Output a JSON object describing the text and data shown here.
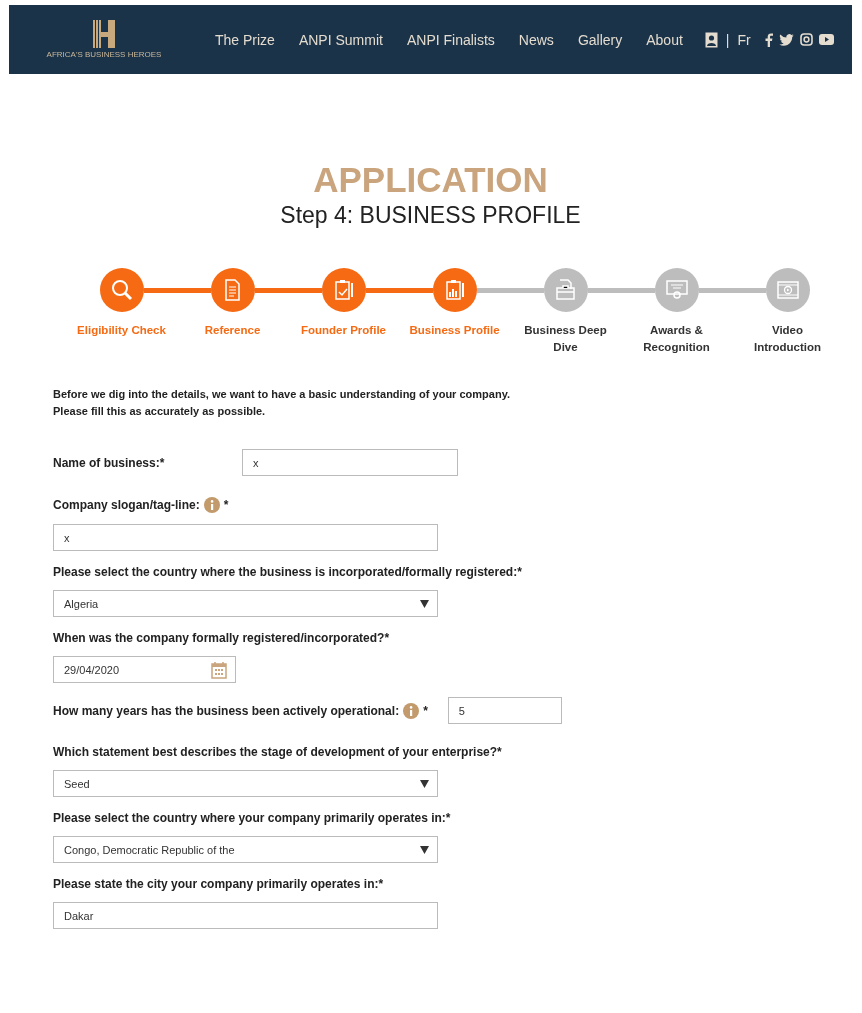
{
  "nav": {
    "logo_text": "AFRICA'S BUSINESS HEROES",
    "links": [
      "The Prize",
      "ANPI Summit",
      "ANPI Finalists",
      "News",
      "Gallery",
      "About"
    ],
    "separator": "|",
    "language": "Fr"
  },
  "heading": {
    "title": "APPLICATION",
    "subtitle": "Step 4: BUSINESS PROFILE"
  },
  "steps": [
    {
      "label": "Eligibility Check",
      "completed": true
    },
    {
      "label": "Reference",
      "completed": true
    },
    {
      "label": "Founder Profile",
      "completed": true
    },
    {
      "label": "Business Profile",
      "completed": true
    },
    {
      "label": "Business Deep Dive",
      "completed": false
    },
    {
      "label": "Awards & Recognition",
      "completed": false
    },
    {
      "label": "Video Introduction",
      "completed": false
    }
  ],
  "intro": [
    "Before we dig into the details, we want to have a basic understanding of your company.",
    "Please fill this as accurately as possible."
  ],
  "fields": [
    {
      "kind": "inline-text",
      "label": "Name of business:*",
      "value": "x"
    },
    {
      "kind": "text",
      "label": "Company slogan/tag-line:",
      "info": true,
      "suffix": "*",
      "value": "x"
    },
    {
      "kind": "select",
      "label": "Please select the country where the business is incorporated/formally registered:*",
      "value": "Algeria"
    },
    {
      "kind": "date",
      "label": "When was the company formally registered/incorporated?*",
      "value": "29/04/2020"
    },
    {
      "kind": "inline-text",
      "label": "How many years has the business been actively operational:",
      "info": true,
      "suffix": "*",
      "value": "5"
    },
    {
      "kind": "select",
      "label": "Which statement best describes the stage of development of your enterprise?*",
      "value": "Seed"
    },
    {
      "kind": "select",
      "label": "Please select the country where your company primarily operates in:*",
      "value": "Congo, Democratic Republic of the"
    },
    {
      "kind": "text",
      "label": "Please state the city your company primarily operates in:*",
      "value": "Dakar"
    }
  ]
}
